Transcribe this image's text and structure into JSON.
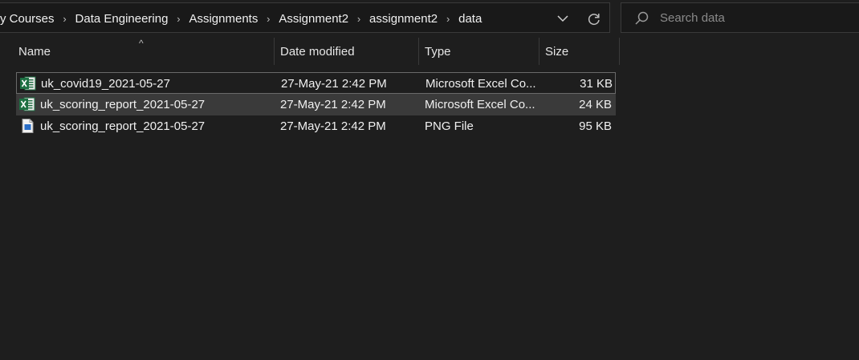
{
  "breadcrumb": {
    "items": [
      "y Courses",
      "Data Engineering",
      "Assignments",
      "Assignment2",
      "assignment2",
      "data"
    ]
  },
  "search": {
    "placeholder": "Search data"
  },
  "columns": {
    "name": "Name",
    "date": "Date modified",
    "type": "Type",
    "size": "Size"
  },
  "files": [
    {
      "name": "uk_covid19_2021-05-27",
      "date": "27-May-21 2:42 PM",
      "type": "Microsoft Excel Co...",
      "size": "31 KB",
      "icon": "excel-icon"
    },
    {
      "name": "uk_scoring_report_2021-05-27",
      "date": "27-May-21 2:42 PM",
      "type": "Microsoft Excel Co...",
      "size": "24 KB",
      "icon": "excel-icon"
    },
    {
      "name": "uk_scoring_report_2021-05-27",
      "date": "27-May-21 2:42 PM",
      "type": "PNG File",
      "size": "95 KB",
      "icon": "png-file-icon"
    }
  ],
  "icons": {
    "dropdown": "chevron-down-icon",
    "refresh": "refresh-icon",
    "search": "search-icon",
    "sort": "sort-ascending-icon"
  },
  "colors": {
    "background": "#1e1e1e",
    "selected_row": "#3a3a3a",
    "excel_green": "#1d6f42",
    "png_blue": "#2b6fc8"
  }
}
